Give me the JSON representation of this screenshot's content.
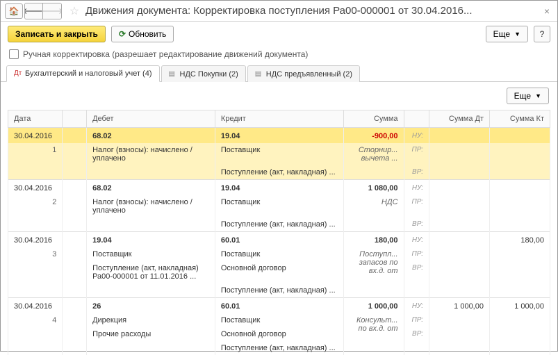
{
  "title": "Движения документа: Корректировка поступления Ра00-000001 от 30.04.2016...",
  "toolbar": {
    "save_close": "Записать и закрыть",
    "refresh": "Обновить",
    "more": "Еще",
    "help": "?"
  },
  "manual_edit_label": "Ручная корректировка (разрешает редактирование движений документа)",
  "tabs": [
    {
      "label": "Бухгалтерский и налоговый учет (4)"
    },
    {
      "label": "НДС Покупки (2)"
    },
    {
      "label": "НДС предъявленный (2)"
    }
  ],
  "subtool_more": "Еще",
  "headers": {
    "date": "Дата",
    "debit": "Дебет",
    "credit": "Кредит",
    "sum": "Сумма",
    "sum_dt": "Сумма Дт",
    "sum_kt": "Сумма Кт"
  },
  "labels": {
    "nu": "НУ:",
    "pr": "ПР:",
    "vr": "ВР:"
  },
  "rows": [
    {
      "date": "30.04.2016",
      "n": "1",
      "hl": true,
      "debit_acc": "68.02",
      "debit_l1": "Налог (взносы): начислено / уплачено",
      "credit_acc": "19.04",
      "credit_l1": "Поставщик",
      "credit_l2": "Поступление (акт, накладная) ...",
      "sum": "-900,00",
      "sum_red": true,
      "note": "Сторнир... вычета ..."
    },
    {
      "date": "30.04.2016",
      "n": "2",
      "debit_acc": "68.02",
      "debit_l1": "Налог (взносы): начислено / уплачено",
      "credit_acc": "19.04",
      "credit_l1": "Поставщик",
      "credit_l2": "Поступление (акт, накладная) ...",
      "sum": "1 080,00",
      "note": "НДС"
    },
    {
      "date": "30.04.2016",
      "n": "3",
      "debit_acc": "19.04",
      "debit_l1": "Поставщик",
      "debit_l2": "Поступление (акт, накладная) Ра00-000001 от 11.01.2016 ...",
      "credit_acc": "60.01",
      "credit_l1": "Поставщик",
      "credit_l2": "Основной договор",
      "credit_l3": "Поступление (акт, накладная) ...",
      "sum": "180,00",
      "note": "Поступл... запасов по вх.д. от",
      "kt": "180,00"
    },
    {
      "date": "30.04.2016",
      "n": "4",
      "debit_acc": "26",
      "debit_l1": "Дирекция",
      "debit_l2": "Прочие расходы",
      "credit_acc": "60.01",
      "credit_l1": "Поставщик",
      "credit_l2": "Основной договор",
      "credit_l3": "Поступление (акт, накладная) ...",
      "sum": "1 000,00",
      "note": "Консульт... по вх.д. от",
      "dt": "1 000,00",
      "kt": "1 000,00"
    }
  ]
}
